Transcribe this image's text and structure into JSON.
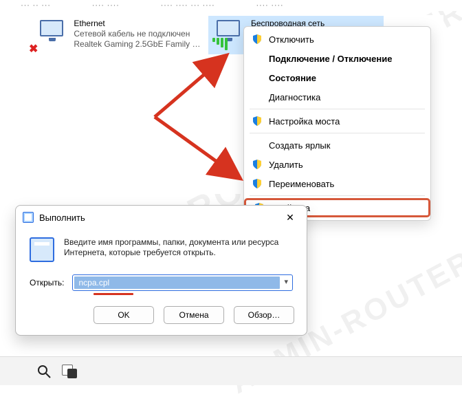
{
  "watermark": "ADMIN-ROUTER.RU",
  "menubar_hint": "………",
  "adapters": {
    "ethernet": {
      "name": "Ethernet",
      "status": "Сетевой кабель не подключен",
      "device": "Realtek Gaming 2.5GbE Family Co..."
    },
    "wifi": {
      "name": "Беспроводная сеть"
    }
  },
  "context_menu": {
    "disable": "Отключить",
    "connect": "Подключение / Отключение",
    "status": "Состояние",
    "diagnose": "Диагностика",
    "bridge": "Настройка моста",
    "shortcut": "Создать ярлык",
    "delete": "Удалить",
    "rename": "Переименовать",
    "properties": "Свойства"
  },
  "run_dialog": {
    "title": "Выполнить",
    "prompt": "Введите имя программы, папки, документа или ресурса Интернета, которые требуется открыть.",
    "open_label": "Открыть:",
    "open_value": "ncpa.cpl",
    "btn_ok": "OK",
    "btn_cancel": "Отмена",
    "btn_browse": "Обзор…",
    "close_glyph": "✕"
  }
}
